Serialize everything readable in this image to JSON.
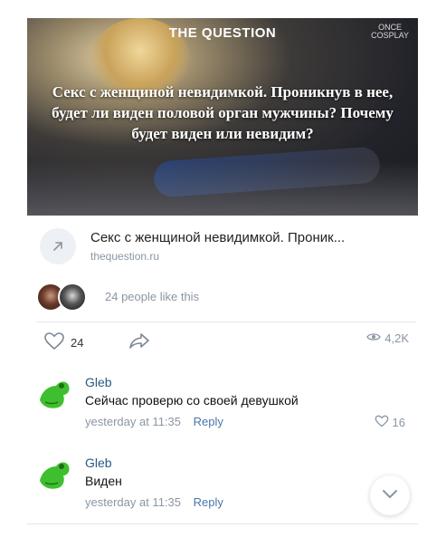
{
  "post": {
    "image": {
      "brand": "THE QUESTION",
      "watermark_line1": "ONCE",
      "watermark_line2": "COSPLAY",
      "headline": "Секс с женщиной невидимкой. Проникнув в нее, будет ли виден половой орган мужчины? Почему будет виден или невидим?"
    },
    "link": {
      "title": "Секс с женщиной невидимкой. Проник...",
      "domain": "thequestion.ru",
      "icon": "arrow-up-right-icon"
    },
    "likes_text": "24 people like this",
    "actions": {
      "like_count": "24",
      "views_count": "4,2K"
    }
  },
  "comments": [
    {
      "author": "Gleb",
      "text": "Сейчас проверю со своей девушкой",
      "time": "yesterday at 11:35",
      "reply_label": "Reply",
      "likes": "16",
      "avatar_icon": "green-frog-icon"
    },
    {
      "author": "Gleb",
      "text": "Виден",
      "time": "yesterday at 11:35",
      "reply_label": "Reply",
      "likes": "",
      "avatar_icon": "green-frog-icon"
    }
  ],
  "colors": {
    "link_blue": "#2a5885",
    "muted": "#8a96a3",
    "frog_green": "#3fbf2f"
  }
}
